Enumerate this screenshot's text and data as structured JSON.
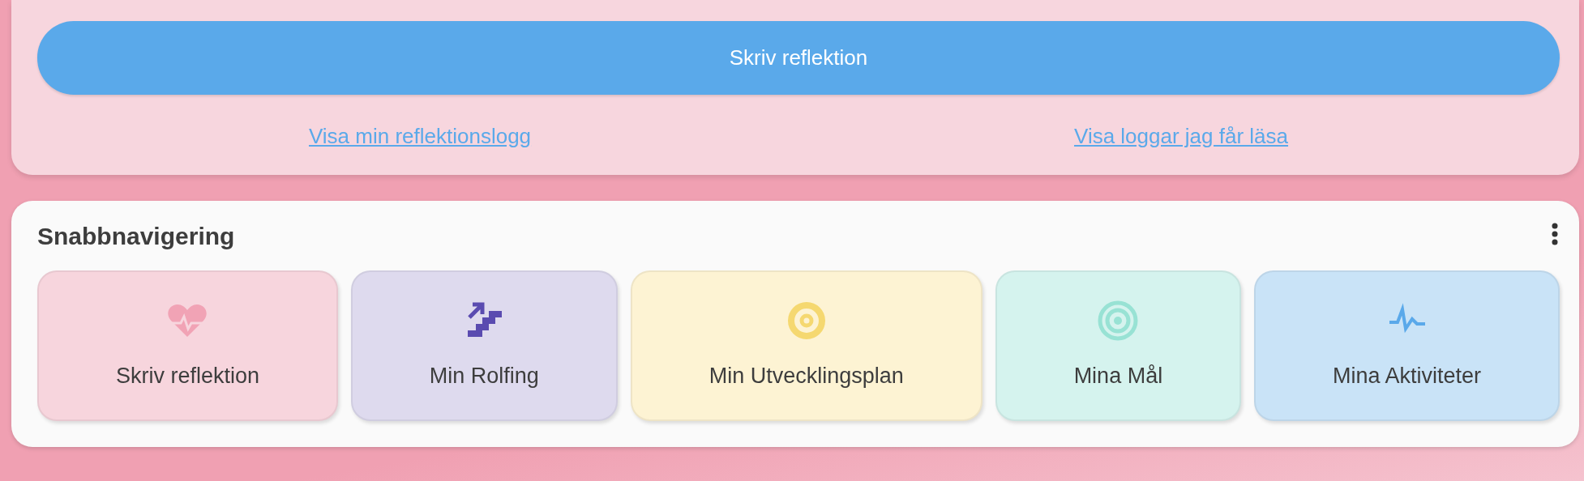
{
  "reflection_card": {
    "button": "Skriv reflektion",
    "links": [
      "Visa min reflektionslogg",
      "Visa loggar jag får läsa"
    ]
  },
  "quick_nav": {
    "title": "Snabbnavigering",
    "tiles": [
      {
        "label": "Skriv reflektion",
        "kind": "heart",
        "color": "#f1a3b5"
      },
      {
        "label": "Min Rolfing",
        "kind": "stairs",
        "color": "#5a4bb0"
      },
      {
        "label": "Min Utvecklingsplan",
        "kind": "plan",
        "color": "#f5d870"
      },
      {
        "label": "Mina Mål",
        "kind": "target",
        "color": "#98e2d4"
      },
      {
        "label": "Mina Aktiviteter",
        "kind": "pulse",
        "color": "#5aa9ea"
      }
    ]
  }
}
